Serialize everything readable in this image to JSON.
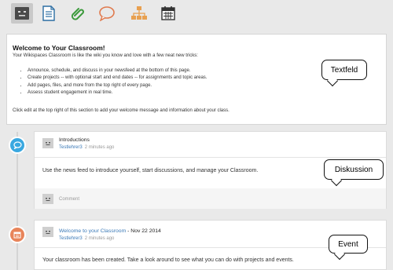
{
  "toolbar": {
    "icons": [
      "home-icon",
      "pages-icon",
      "files-icon",
      "discussions-icon",
      "projects-icon",
      "events-icon"
    ]
  },
  "welcome": {
    "title": "Welcome to Your Classroom!",
    "intro": "Your Wikispaces Classroom is like the wiki you know and love with a few neat new tricks:",
    "bullets": [
      "Announce, schedule, and discuss in your newsfeed at the bottom of this page.",
      "Create projects -- with optional start and end dates -- for assignments and topic areas.",
      "Add pages, files, and more from the top right of every page.",
      "Assess student engagement in real time."
    ],
    "outro": "Click edit at the top right of this section to add your welcome message and information about your class."
  },
  "callouts": {
    "textfeld": "Textfeld",
    "diskussion": "Diskussion",
    "event": "Event"
  },
  "feed": {
    "discussion": {
      "title": "Introductions",
      "author": "Testlehrer3",
      "time": "2 minutes ago",
      "body": "Use the news feed to introduce yourself, start discussions, and manage your Classroom.",
      "comment_label": "Comment"
    },
    "event": {
      "title": "Welcome to your Classroom",
      "date": " - Nov 22 2014",
      "author": "Testlehrer3",
      "time": "2 minutes ago",
      "body": "Your classroom has been created. Take a look around to see what you can do with projects and events."
    }
  },
  "colors": {
    "discussion_bubble": "#3aa8e0",
    "event_bubble": "#e8845a",
    "link": "#3a79b7"
  }
}
